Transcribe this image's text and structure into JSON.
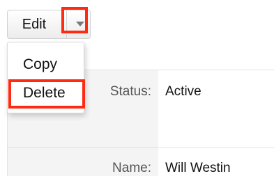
{
  "toolbar": {
    "edit_label": "Edit",
    "dropdown_icon": "chevron-down-icon"
  },
  "dropdown_menu": {
    "items": [
      {
        "label": "Copy"
      },
      {
        "label": "Delete",
        "highlighted": true
      }
    ]
  },
  "details": {
    "status": {
      "label": "Status:",
      "value": "Active"
    },
    "name": {
      "label": "Name:",
      "value": "Will Westin"
    }
  },
  "colors": {
    "highlight": "#ff2a12",
    "label_column_bg": "#f4f4f4"
  }
}
